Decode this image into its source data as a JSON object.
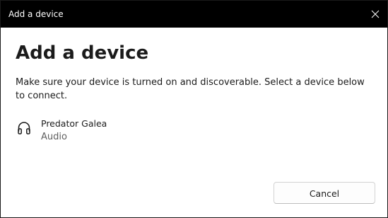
{
  "window": {
    "title": "Add a device"
  },
  "dialog": {
    "heading": "Add a device",
    "description": "Make sure your device is turned on and discoverable. Select a device below to connect.",
    "devices": [
      {
        "name": "Predator Galea",
        "type": "Audio",
        "icon": "headphones-icon"
      }
    ],
    "cancel_label": "Cancel"
  },
  "colors": {
    "titlebar_bg": "#000000",
    "titlebar_text": "#ffffff",
    "text_primary": "#1b1b1b",
    "text_secondary": "#5f5f5f"
  }
}
